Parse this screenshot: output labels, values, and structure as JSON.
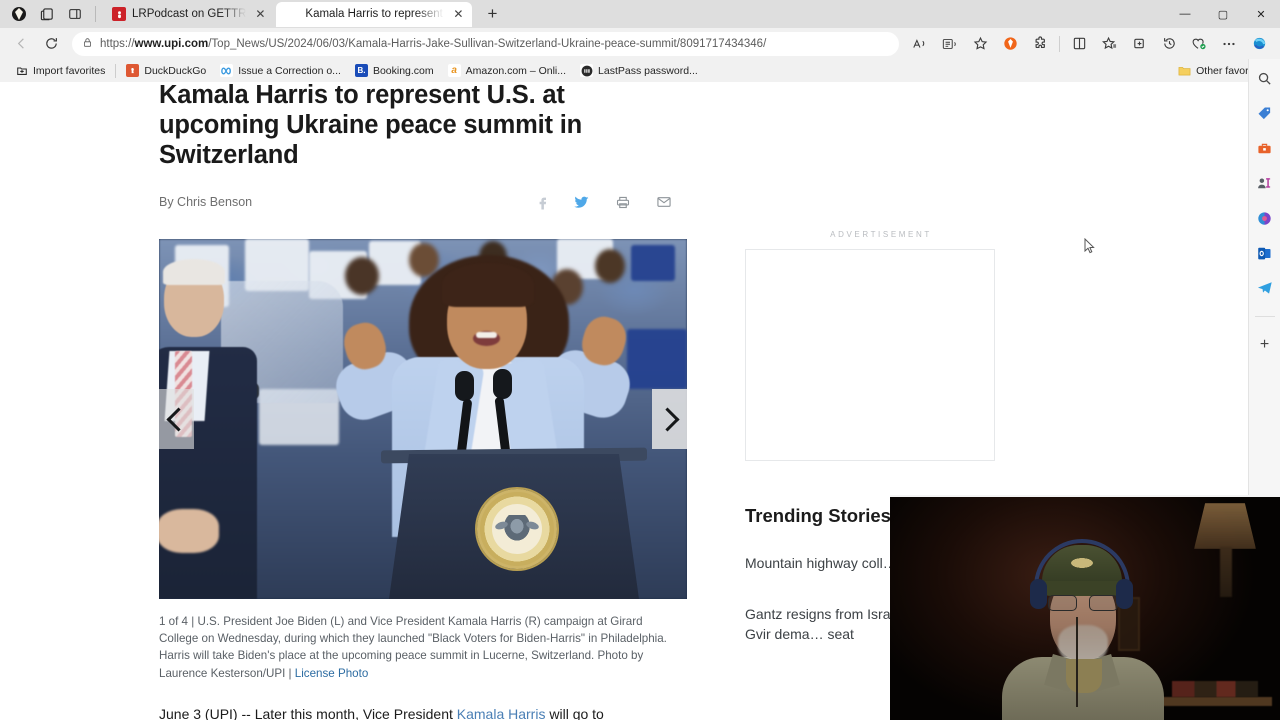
{
  "window": {
    "controls": {
      "minimize": "—",
      "maximize": "▢",
      "close": "✕"
    }
  },
  "tabstrip": {
    "tabs": [
      {
        "title": "LRPodcast on GETTR",
        "favicon_text": "G",
        "active": false
      },
      {
        "title": "Kamala Harris to represent U.S. a",
        "favicon_text": "UPI",
        "active": true
      }
    ],
    "new_tab_label": "+",
    "close_label": "✕"
  },
  "navbar": {
    "back_label": "←",
    "reload_label": "⟳",
    "lock_label": "🔒",
    "url_prefix": "https://",
    "url_domain": "www.upi.com",
    "url_path": "/Top_News/US/2024/06/03/Kamala-Harris-Jake-Sullivan-Switzerland-Ukraine-peace-summit/8091717434346/",
    "right_icons": [
      {
        "name": "read-aloud-icon",
        "glyph": "A"
      },
      {
        "name": "immersive-reader-icon",
        "glyph": "▤"
      },
      {
        "name": "add-favorite-icon",
        "glyph": "☆"
      },
      {
        "name": "brave-shield-icon",
        "glyph": "●"
      },
      {
        "name": "extension-puzzle-icon",
        "glyph": "✧"
      },
      {
        "name": "split-screen-icon",
        "glyph": "▯"
      },
      {
        "name": "favorites-icon",
        "glyph": "☆"
      },
      {
        "name": "collections-icon",
        "glyph": "⊞"
      },
      {
        "name": "history-icon",
        "glyph": "↺"
      },
      {
        "name": "browser-essentials-icon",
        "glyph": "♡"
      },
      {
        "name": "settings-more-icon",
        "glyph": "⋯"
      },
      {
        "name": "copilot-icon",
        "glyph": "◉"
      }
    ]
  },
  "bookmarks": {
    "items": [
      {
        "label": "Import favorites",
        "icon_text": "",
        "icon_color": "#ffffff"
      },
      {
        "label": "DuckDuckGo",
        "icon_text": "",
        "icon_color": "#de5833"
      },
      {
        "label": "Issue a Correction o...",
        "icon_text": "",
        "icon_color": "#ffffff"
      },
      {
        "label": "Booking.com",
        "icon_text": "B.",
        "icon_color": "#1a4cb8"
      },
      {
        "label": "Amazon.com – Onli...",
        "icon_text": "a",
        "icon_color": "#ffffff"
      },
      {
        "label": "LastPass password...",
        "icon_text": "",
        "icon_color": "#ffffff"
      }
    ],
    "other_favorites": "Other favorites",
    "search_icon": "search-icon"
  },
  "article": {
    "headline": "Kamala Harris to represent U.S. at upcoming Ukraine peace summit in Switzerland",
    "byline": "By Chris Benson",
    "share": [
      {
        "name": "facebook-share-icon",
        "glyph": "f"
      },
      {
        "name": "twitter-share-icon",
        "glyph": "🐦"
      },
      {
        "name": "print-icon",
        "glyph": "⎙"
      },
      {
        "name": "email-share-icon",
        "glyph": "✉"
      }
    ],
    "caption": "1 of 4 | U.S. President Joe Biden (L) and Vice President Kamala Harris (R) campaign at Girard College on Wednesday, during which they launched \"Black Voters for Biden-Harris\" in Philadelphia. Harris will take Biden's place at the upcoming peace summit in Lucerne, Switzerland. Photo by Laurence Kesterson/UPI | ",
    "license_link": "License Photo",
    "body_lead": "June 3 (UPI) -- Later this month, Vice President ",
    "body_link": "Kamala Harris",
    "body_tail": " will go to",
    "carousel": {
      "prev": "‹",
      "next": "›"
    },
    "photo_seal_text": "SEAL OF THE PRESIDENT OF THE UNITED STATES"
  },
  "rail": {
    "ad_label": "ADVERTISEMENT",
    "trending_title": "Trending Stories",
    "stories": [
      "Mountain highway coll… landslide",
      "Gantz resigns from Isra… cabinet; Ben-Gvir dema… seat"
    ]
  },
  "edge_sidebar": {
    "items": [
      {
        "name": "search-icon",
        "glyph": "⌕"
      },
      {
        "name": "shopping-tag-icon",
        "glyph": "🏷"
      },
      {
        "name": "tools-icon",
        "glyph": "🧰"
      },
      {
        "name": "contacts-icon",
        "glyph": "👥"
      },
      {
        "name": "microsoft-365-icon",
        "glyph": "◍"
      },
      {
        "name": "outlook-icon",
        "glyph": "✉"
      },
      {
        "name": "telegram-icon",
        "glyph": "➤"
      }
    ],
    "add_label": "+"
  },
  "colors": {
    "accent_blue": "#2d6ca2",
    "chrome_bg": "#f1f1f1",
    "tab_inactive": "#dedede",
    "link": "#4a7fb5"
  }
}
